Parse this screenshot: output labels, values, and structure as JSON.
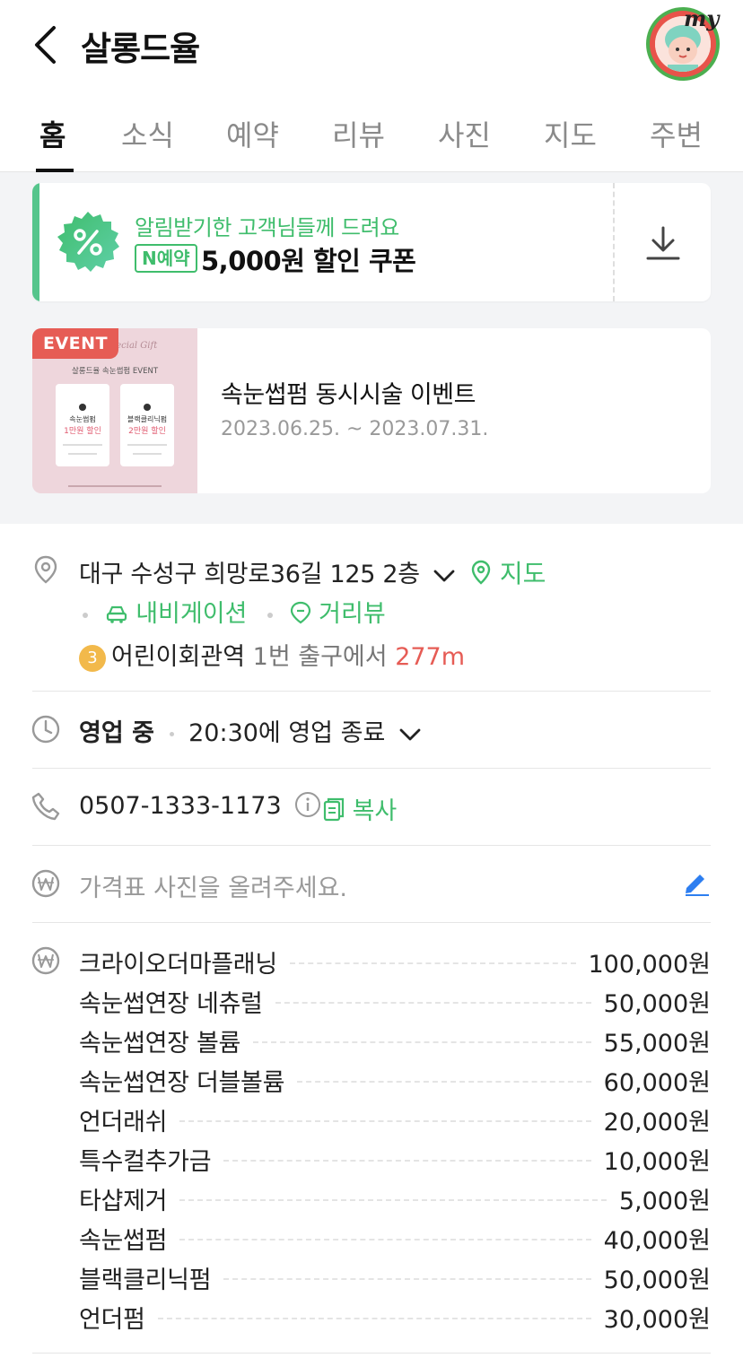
{
  "header": {
    "title": "살롱드율",
    "avatar_label": "my"
  },
  "tabs": [
    {
      "label": "홈",
      "active": true
    },
    {
      "label": "소식"
    },
    {
      "label": "예약"
    },
    {
      "label": "리뷰"
    },
    {
      "label": "사진"
    },
    {
      "label": "지도"
    },
    {
      "label": "주변"
    }
  ],
  "coupon": {
    "headline": "알림받기한 고객님들께 드려요",
    "badge": "N예약",
    "amount": "5,000원 할인 쿠폰"
  },
  "event": {
    "badge": "EVENT",
    "title": "속눈썹펌 동시시술 이벤트",
    "date_range": "2023.06.25. ~ 2023.07.31.",
    "thumb_title": "살롱드율 속눈썹펌 EVENT",
    "thumb_left_label": "속눈썹펌",
    "thumb_left_discount": "1만원 할인",
    "thumb_right_label": "블랙클리닉펌",
    "thumb_right_discount": "2만원 할인"
  },
  "info": {
    "address": "대구 수성구 희망로36길 125 2층",
    "map_link": "지도",
    "navigation": "내비게이션",
    "street_view": "거리뷰",
    "subway_line": "3",
    "subway_station": "어린이회관역",
    "subway_exit": "1번 출구에서",
    "subway_distance": "277m",
    "status": "영업 중",
    "hours": "20:30에 영업 종료",
    "phone": "0507-1333-1173",
    "copy": "복사",
    "price_upload": "가격표 사진을 올려주세요."
  },
  "prices": [
    {
      "name": "크라이오더마플래닝",
      "price": "100,000원"
    },
    {
      "name": "속눈썹연장 네츄럴",
      "price": "50,000원"
    },
    {
      "name": "속눈썹연장 볼륨",
      "price": "55,000원"
    },
    {
      "name": "속눈썹연장 더블볼륨",
      "price": "60,000원"
    },
    {
      "name": "언더래쉬",
      "price": "20,000원"
    },
    {
      "name": "특수컬추가금",
      "price": "10,000원"
    },
    {
      "name": "타샵제거",
      "price": "5,000원"
    },
    {
      "name": "속눈썹펌",
      "price": "40,000원"
    },
    {
      "name": "블랙클리닉펌",
      "price": "50,000원"
    },
    {
      "name": "언더펌",
      "price": "30,000원"
    }
  ],
  "colors": {
    "accent_green": "#3fbd6c",
    "distance_red": "#e65c55",
    "event_badge": "#e65c55",
    "subway_line3": "#f2b94b",
    "edit_blue": "#2d7ef0"
  }
}
